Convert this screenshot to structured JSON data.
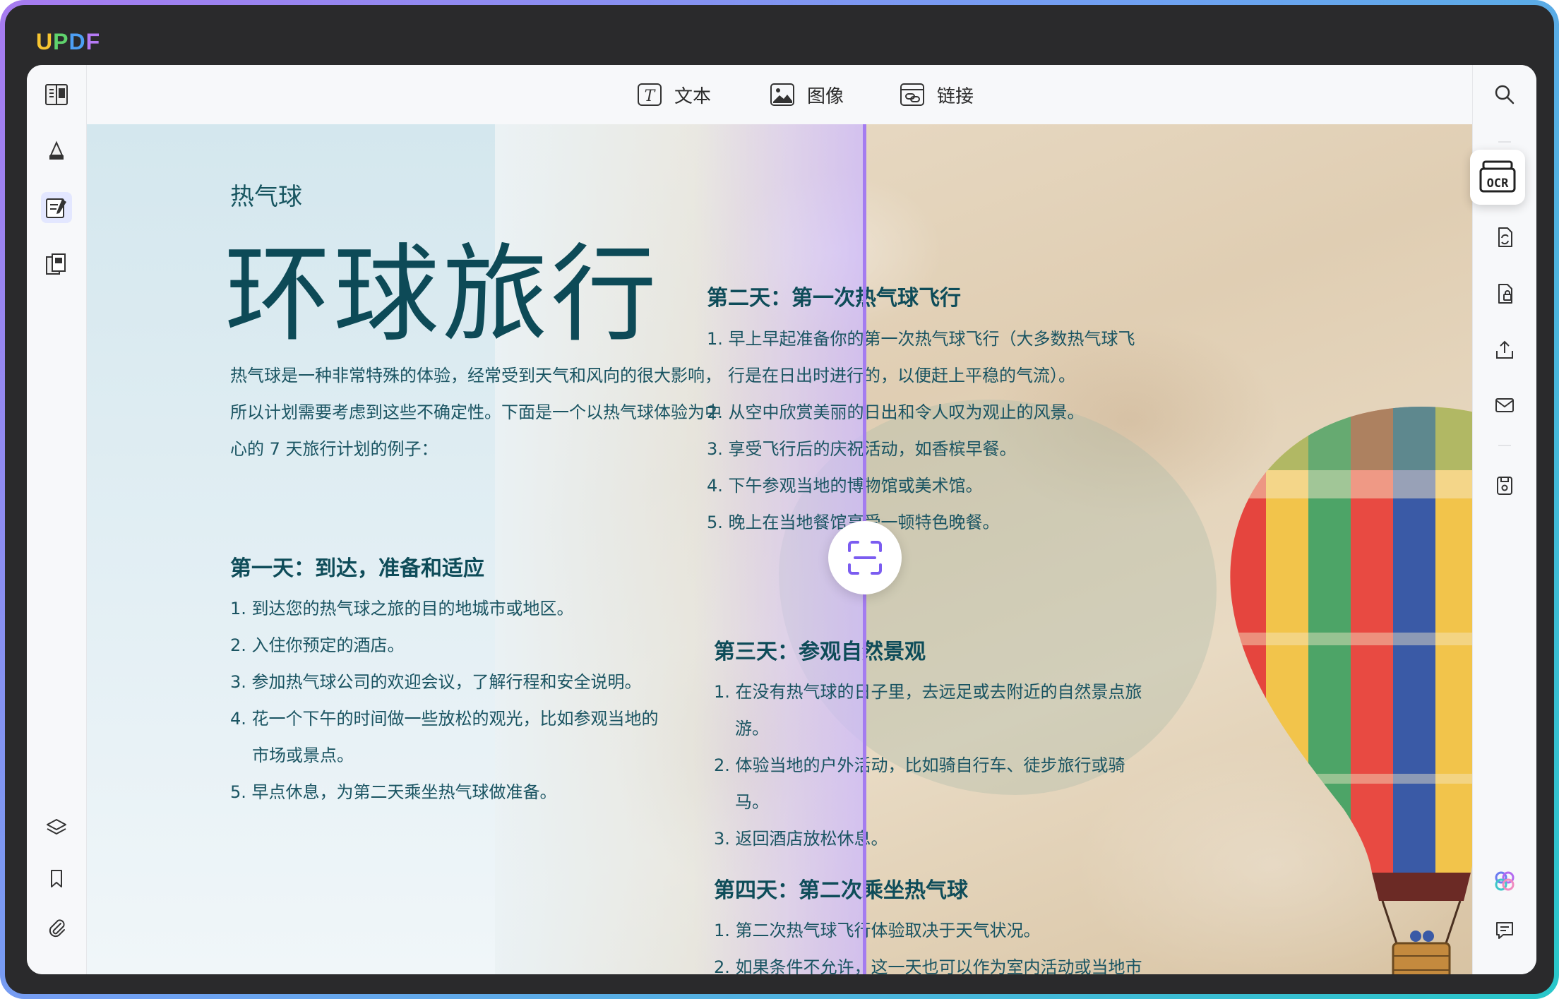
{
  "app": {
    "logo": {
      "u": "U",
      "p": "P",
      "d": "D",
      "f": "F"
    }
  },
  "toolbar": {
    "text_label": "文本",
    "image_label": "图像",
    "link_label": "链接"
  },
  "document": {
    "subtitle": "热气球",
    "title": "环球旅行",
    "intro": "热气球是一种非常特殊的体验，经常受到天气和风向的很大影响，所以计划需要考虑到这些不确定性。下面是一个以热气球体验为中心的 7 天旅行计划的例子：",
    "day1": {
      "heading": "第一天：到达，准备和适应",
      "items": [
        "1. 到达您的热气球之旅的目的地城市或地区。",
        "2. 入住你预定的酒店。",
        "3. 参加热气球公司的欢迎会议，了解行程和安全说明。",
        "4. 花一个下午的时间做一些放松的观光，比如参观当地的",
        "市场或景点。",
        "5. 早点休息，为第二天乘坐热气球做准备。"
      ]
    },
    "day2": {
      "heading": "第二天：第一次热气球飞行",
      "items": [
        "1. 早上早起准备你的第一次热气球飞行（大多数热气球飞",
        "行是在日出时进行的，以便赶上平稳的气流）。",
        "2. 从空中欣赏美丽的日出和令人叹为观止的风景。",
        "3. 享受飞行后的庆祝活动，如香槟早餐。",
        "4. 下午参观当地的博物馆或美术馆。",
        "5. 晚上在当地餐馆享受一顿特色晚餐。"
      ]
    },
    "day3": {
      "heading": "第三天：参观自然景观",
      "items": [
        "1. 在没有热气球的日子里，去远足或去附近的自然景点旅",
        "游。",
        "2. 体验当地的户外活动，比如骑自行车、徒步旅行或骑",
        "马。",
        "3. 返回酒店放松休息。"
      ]
    },
    "day4": {
      "heading": "第四天：第二次乘坐热气球",
      "items": [
        "1. 第二次热气球飞行体验取决于天气状况。",
        "2. 如果条件不允许，这一天也可以作为室内活动或当地市"
      ]
    }
  },
  "right_tools": {
    "ocr_label": "OCR"
  },
  "colors": {
    "accent": "#a47cf0",
    "text_teal": "#0f4f5c"
  }
}
